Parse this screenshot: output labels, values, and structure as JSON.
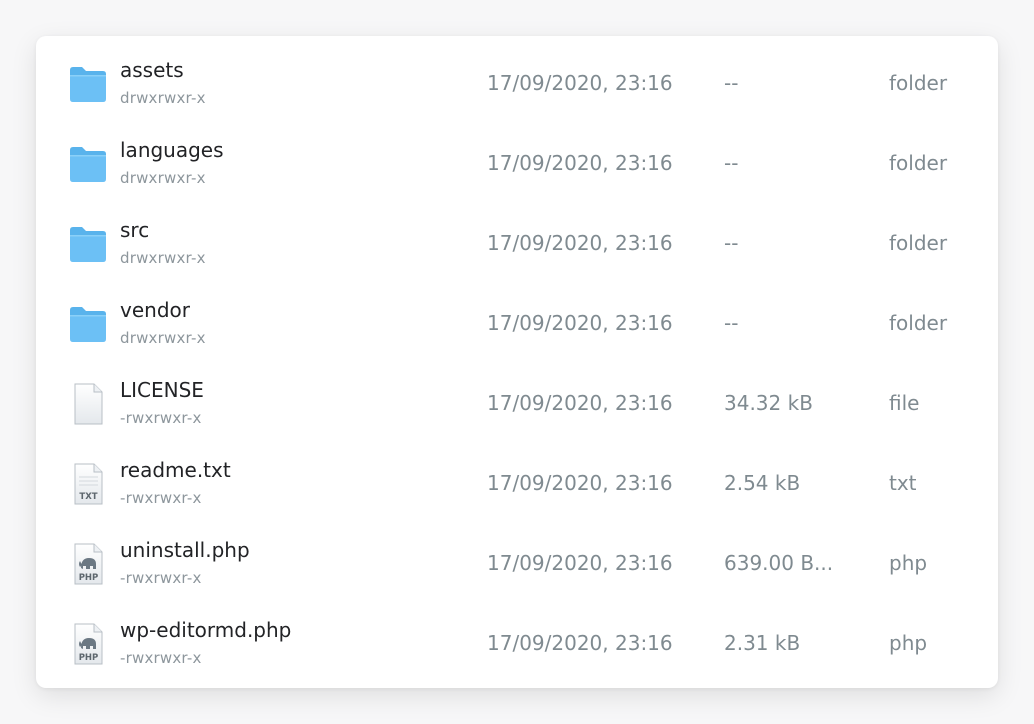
{
  "files": [
    {
      "name": "assets",
      "perms": "drwxrwxr-x",
      "date": "17/09/2020, 23:16",
      "size": "--",
      "type": "folder",
      "icon": "folder-icon"
    },
    {
      "name": "languages",
      "perms": "drwxrwxr-x",
      "date": "17/09/2020, 23:16",
      "size": "--",
      "type": "folder",
      "icon": "folder-icon"
    },
    {
      "name": "src",
      "perms": "drwxrwxr-x",
      "date": "17/09/2020, 23:16",
      "size": "--",
      "type": "folder",
      "icon": "folder-icon"
    },
    {
      "name": "vendor",
      "perms": "drwxrwxr-x",
      "date": "17/09/2020, 23:16",
      "size": "--",
      "type": "folder",
      "icon": "folder-icon"
    },
    {
      "name": "LICENSE",
      "perms": "-rwxrwxr-x",
      "date": "17/09/2020, 23:16",
      "size": "34.32 kB",
      "type": "file",
      "icon": "generic-file-icon"
    },
    {
      "name": "readme.txt",
      "perms": "-rwxrwxr-x",
      "date": "17/09/2020, 23:16",
      "size": "2.54 kB",
      "type": "txt",
      "icon": "txt-file-icon",
      "icon_label": "TXT"
    },
    {
      "name": "uninstall.php",
      "perms": "-rwxrwxr-x",
      "date": "17/09/2020, 23:16",
      "size": "639.00 B...",
      "type": "php",
      "icon": "php-file-icon",
      "icon_label": "PHP"
    },
    {
      "name": "wp-editormd.php",
      "perms": "-rwxrwxr-x",
      "date": "17/09/2020, 23:16",
      "size": "2.31 kB",
      "type": "php",
      "icon": "php-file-icon",
      "icon_label": "PHP"
    }
  ],
  "colors": {
    "folder": "#6cc0f5",
    "folder_tab": "#59b3ec",
    "name_text": "#222326",
    "muted_text": "#7f8a90",
    "perms_text": "#8d969c"
  }
}
